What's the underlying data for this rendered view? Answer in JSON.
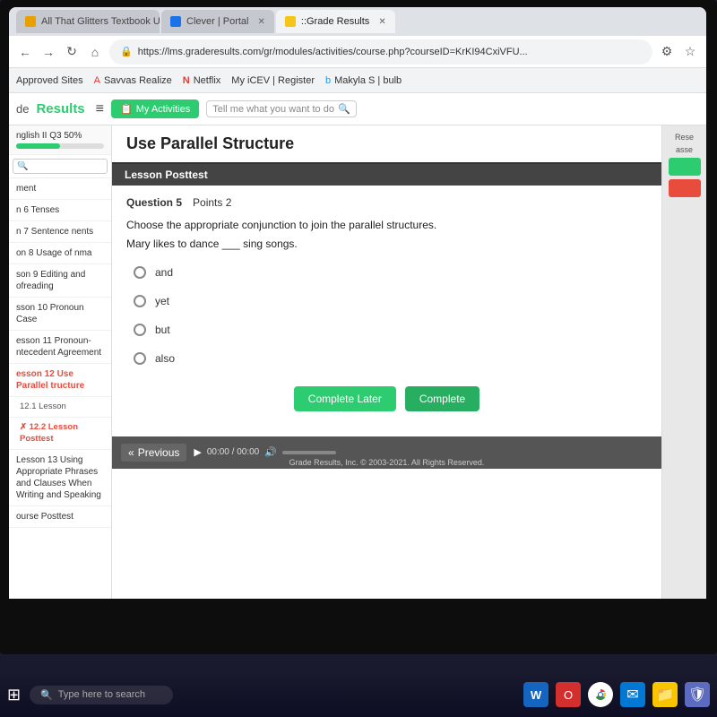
{
  "browser": {
    "tabs": [
      {
        "id": "tab1",
        "label": "All That Glitters Textbook Unit 4",
        "active": false,
        "favicon": "orange"
      },
      {
        "id": "tab2",
        "label": "Clever | Portal",
        "active": false,
        "favicon": "blue"
      },
      {
        "id": "tab3",
        "label": "::Grade Results",
        "active": true,
        "favicon": "gold"
      }
    ],
    "url": "https://lms.graderesults.com/gr/modules/activities/course.php?courseID=KrKI94CxiVFU...",
    "bookmarks": [
      "Approved Sites",
      "Savvas Realize",
      "Netflix",
      "My iCEV | Register",
      "Makyla S | bulb"
    ]
  },
  "app_header": {
    "logo_prefix": "de",
    "logo_brand": "Results",
    "menu_icon": "≡",
    "activities_label": "My Activities",
    "search_placeholder": "Tell me what you want to do"
  },
  "sidebar": {
    "course_label": "nglish II Q3",
    "progress_pct": "50%",
    "progress_value": 50,
    "items": [
      {
        "label": "ment",
        "sub": false
      },
      {
        "label": "n 6 Tenses",
        "sub": false
      },
      {
        "label": "n 7 Sentence\nnents",
        "sub": false
      },
      {
        "label": "on 8 Usage of\nnma",
        "sub": false
      },
      {
        "label": "son 9 Editing and\nofreading",
        "sub": false
      },
      {
        "label": "sson 10 Pronoun Case",
        "sub": false
      },
      {
        "label": "esson 11 Pronoun-\nntecedent Agreement",
        "sub": false
      },
      {
        "label": "esson 12 Use Parallel\ntructure",
        "sub": false,
        "active": true
      },
      {
        "label": "12.1 Lesson",
        "sub": true
      },
      {
        "label": "12.2 Lesson Posttest",
        "sub": true,
        "active": true
      },
      {
        "label": "Lesson 13 Using\nAppropriate Phrases and\nClauses When Writing\nand Speaking",
        "sub": false
      },
      {
        "label": "ourse Posttest",
        "sub": false
      }
    ]
  },
  "page": {
    "title": "Use Parallel Structure",
    "section": "Lesson Posttest",
    "question": {
      "number": "Question 5",
      "points": "Points 2",
      "instruction": "Choose the appropriate conjunction to join the parallel structures.",
      "sentence": "Mary likes to dance ___ sing songs.",
      "options": [
        {
          "id": "opt1",
          "label": "and"
        },
        {
          "id": "opt2",
          "label": "yet"
        },
        {
          "id": "opt3",
          "label": "but"
        },
        {
          "id": "opt4",
          "label": "also"
        }
      ]
    },
    "buttons": {
      "complete_later": "Complete Later",
      "complete": "Complete"
    },
    "right_panel": {
      "label": "Rese",
      "label2": "asse"
    }
  },
  "bottom_bar": {
    "prev_label": "Previous",
    "time_current": "00:00",
    "time_total": "00:00",
    "copyright": "Grade Results, Inc. © 2003-2021. All Rights Reserved."
  },
  "taskbar": {
    "search_placeholder": "Type here to search",
    "icons": [
      "⊞",
      "W",
      "O",
      "●",
      "✉",
      "📁",
      "🛡"
    ]
  }
}
